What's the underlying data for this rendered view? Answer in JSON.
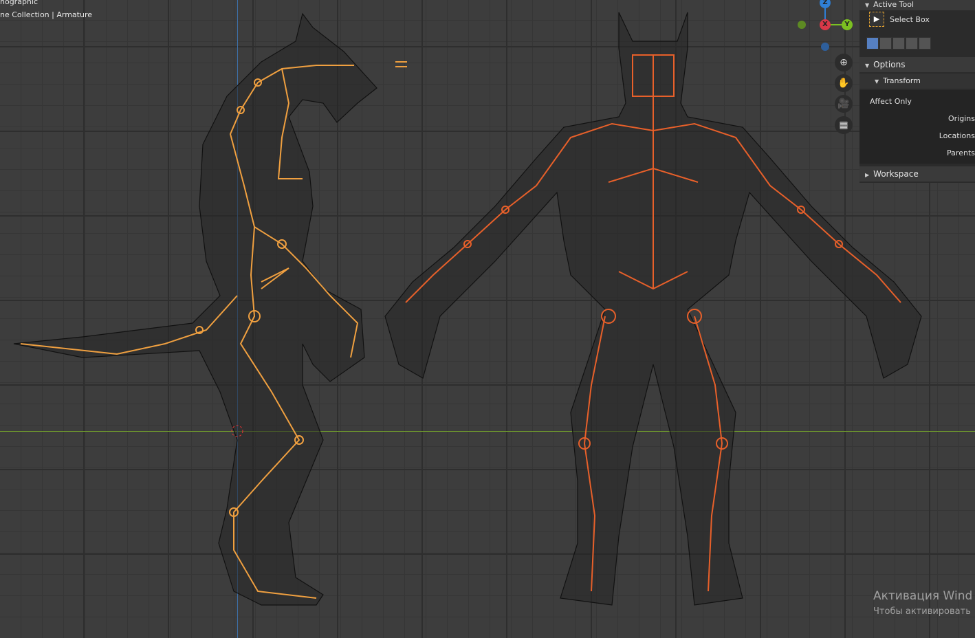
{
  "viewport": {
    "view_name": "nographic",
    "collection_info": "ne Collection | Armature"
  },
  "gizmo": {
    "z": "Z",
    "x": "X",
    "y": "Y"
  },
  "nav": [
    {
      "icon": "zoom-icon",
      "glyph": "⊕"
    },
    {
      "icon": "hand-pan-icon",
      "glyph": "✋"
    },
    {
      "icon": "camera-icon",
      "glyph": "🎥"
    },
    {
      "icon": "grid-icon",
      "glyph": "▦"
    }
  ],
  "sidebar": {
    "active_tool_header": "Active Tool",
    "tool_name": "Select Box",
    "options": "Options",
    "transform": "Transform",
    "affect_only": "Affect Only",
    "origins": "Origins",
    "locations": "Locations",
    "parents": "Parents",
    "workspace": "Workspace"
  },
  "watermark": {
    "line1": "Активация Wind",
    "line2": "Чтобы активировать"
  },
  "colors": {
    "bone": "#f0a040",
    "bone_front": "#e8602a",
    "axis_x": "#6f9a2d",
    "axis_z": "#3d6fa8"
  }
}
